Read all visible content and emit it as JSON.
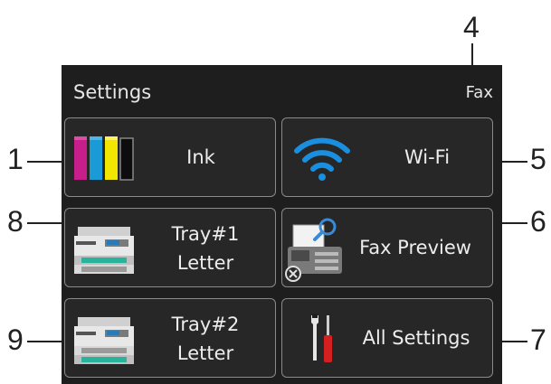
{
  "header": {
    "title": "Settings",
    "right_label": "Fax"
  },
  "tiles": [
    {
      "label": "Ink",
      "icon": "ink-cartridges-icon",
      "colors": [
        "#c81e8c",
        "#1a9ad6",
        "#f2e600",
        "#111111"
      ]
    },
    {
      "label": "Wi-Fi",
      "icon": "wifi-icon",
      "color": "#1a8fe0"
    },
    {
      "label_line1": "Tray#1",
      "label_line2": "Letter",
      "icon": "printer-tray-icon"
    },
    {
      "label": "Fax Preview",
      "icon": "fax-preview-icon"
    },
    {
      "label_line1": "Tray#2",
      "label_line2": "Letter",
      "icon": "printer-tray-icon"
    },
    {
      "label": "All Settings",
      "icon": "tools-icon"
    }
  ],
  "callouts": {
    "ink": "1",
    "fax": "4",
    "wifi": "5",
    "fax_preview": "6",
    "all_settings": "7",
    "tray1": "8",
    "tray2": "9"
  }
}
